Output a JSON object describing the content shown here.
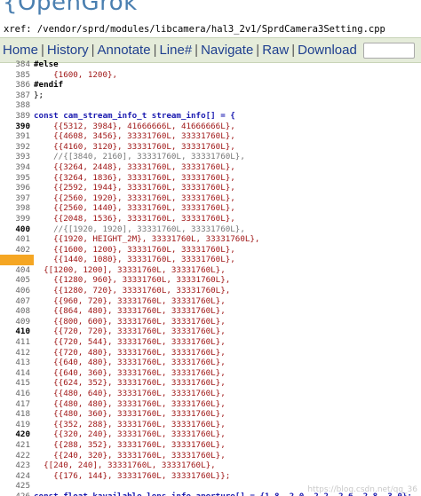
{
  "header": {
    "logo": "{OpenGrok",
    "xref": "xref: /vendor/sprd/modules/libcamera/hal3_2v1/SprdCamera3Setting.cpp"
  },
  "nav": {
    "items": [
      "Home",
      "History",
      "Annotate",
      "Line#",
      "Navigate",
      "Raw",
      "Download"
    ]
  },
  "code": {
    "lines": [
      {
        "n": "384",
        "t": "#else",
        "k": "pp"
      },
      {
        "n": "385",
        "t": "    {1600, 1200},",
        "k": "num"
      },
      {
        "n": "386",
        "t": "#endif",
        "k": "pp"
      },
      {
        "n": "387",
        "t": "};",
        "k": "plain"
      },
      {
        "n": "388",
        "t": "",
        "k": "plain"
      },
      {
        "n": "389",
        "t": "const cam_stream_info_t stream_info[] = {",
        "k": "kw"
      },
      {
        "n": "390",
        "t": "    {{5312, 3984}, 41666666L, 41666666L},",
        "k": "num",
        "b": true
      },
      {
        "n": "391",
        "t": "    {{4608, 3456}, 33331760L, 33331760L},",
        "k": "num"
      },
      {
        "n": "392",
        "t": "    {{4160, 3120}, 33331760L, 33331760L},",
        "k": "num"
      },
      {
        "n": "393",
        "t": "    //{[3840, 2160], 33331760L, 33331760L},",
        "k": "cm"
      },
      {
        "n": "394",
        "t": "    {{3264, 2448}, 33331760L, 33331760L},",
        "k": "num"
      },
      {
        "n": "395",
        "t": "    {{3264, 1836}, 33331760L, 33331760L},",
        "k": "num"
      },
      {
        "n": "396",
        "t": "    {{2592, 1944}, 33331760L, 33331760L},",
        "k": "num"
      },
      {
        "n": "397",
        "t": "    {{2560, 1920}, 33331760L, 33331760L},",
        "k": "num"
      },
      {
        "n": "398",
        "t": "    {{2560, 1440}, 33331760L, 33331760L},",
        "k": "num"
      },
      {
        "n": "399",
        "t": "    {{2048, 1536}, 33331760L, 33331760L},",
        "k": "num"
      },
      {
        "n": "400",
        "t": "    //{[1920, 1920], 33331760L, 33331760L},",
        "k": "cm",
        "b": true
      },
      {
        "n": "401",
        "t": "    {{1920, HEIGHT_2M}, 33331760L, 33331760L},",
        "k": "num"
      },
      {
        "n": "402",
        "t": "    {{1600, 1200}, 33331760L, 33331760L},",
        "k": "num"
      },
      {
        "n": "403",
        "t": "    {{1440, 1080}, 33331760L, 33331760L},",
        "k": "num",
        "hl": true
      },
      {
        "n": "404",
        "t": "  {[1200, 1200], 33331760L, 33331760L},",
        "k": "num"
      },
      {
        "n": "405",
        "t": "    {{1280, 960}, 33331760L, 33331760L},",
        "k": "num"
      },
      {
        "n": "406",
        "t": "    {{1280, 720}, 33331760L, 33331760L},",
        "k": "num"
      },
      {
        "n": "407",
        "t": "    {{960, 720}, 33331760L, 33331760L},",
        "k": "num"
      },
      {
        "n": "408",
        "t": "    {{864, 480}, 33331760L, 33331760L},",
        "k": "num"
      },
      {
        "n": "409",
        "t": "    {{800, 600}, 33331760L, 33331760L},",
        "k": "num"
      },
      {
        "n": "410",
        "t": "    {{720, 720}, 33331760L, 33331760L},",
        "k": "num",
        "b": true
      },
      {
        "n": "411",
        "t": "    {{720, 544}, 33331760L, 33331760L},",
        "k": "num"
      },
      {
        "n": "412",
        "t": "    {{720, 480}, 33331760L, 33331760L},",
        "k": "num"
      },
      {
        "n": "413",
        "t": "    {{640, 480}, 33331760L, 33331760L},",
        "k": "num"
      },
      {
        "n": "414",
        "t": "    {{640, 360}, 33331760L, 33331760L},",
        "k": "num"
      },
      {
        "n": "415",
        "t": "    {{624, 352}, 33331760L, 33331760L},",
        "k": "num"
      },
      {
        "n": "416",
        "t": "    {{480, 640}, 33331760L, 33331760L},",
        "k": "num"
      },
      {
        "n": "417",
        "t": "    {{480, 480}, 33331760L, 33331760L},",
        "k": "num"
      },
      {
        "n": "418",
        "t": "    {{480, 360}, 33331760L, 33331760L},",
        "k": "num"
      },
      {
        "n": "419",
        "t": "    {{352, 288}, 33331760L, 33331760L},",
        "k": "num"
      },
      {
        "n": "420",
        "t": "    {{320, 240}, 33331760L, 33331760L},",
        "k": "num",
        "b": true
      },
      {
        "n": "421",
        "t": "    {{288, 352}, 33331760L, 33331760L},",
        "k": "num"
      },
      {
        "n": "422",
        "t": "    {{240, 320}, 33331760L, 33331760L},",
        "k": "num"
      },
      {
        "n": "423",
        "t": "  {[240, 240], 33331760L, 33331760L},",
        "k": "num"
      },
      {
        "n": "424",
        "t": "    {{176, 144}, 33331760L, 33331760L}};",
        "k": "num"
      },
      {
        "n": "425",
        "t": "",
        "k": "plain"
      },
      {
        "n": "426",
        "t": "const float kavailable_lens_info_aperture[] = {1.8, 2.0, 2.2, 2.6, 2.8, 3.0};",
        "k": "kw"
      }
    ]
  },
  "watermark": "https://blog.csdn.net/qq_36"
}
